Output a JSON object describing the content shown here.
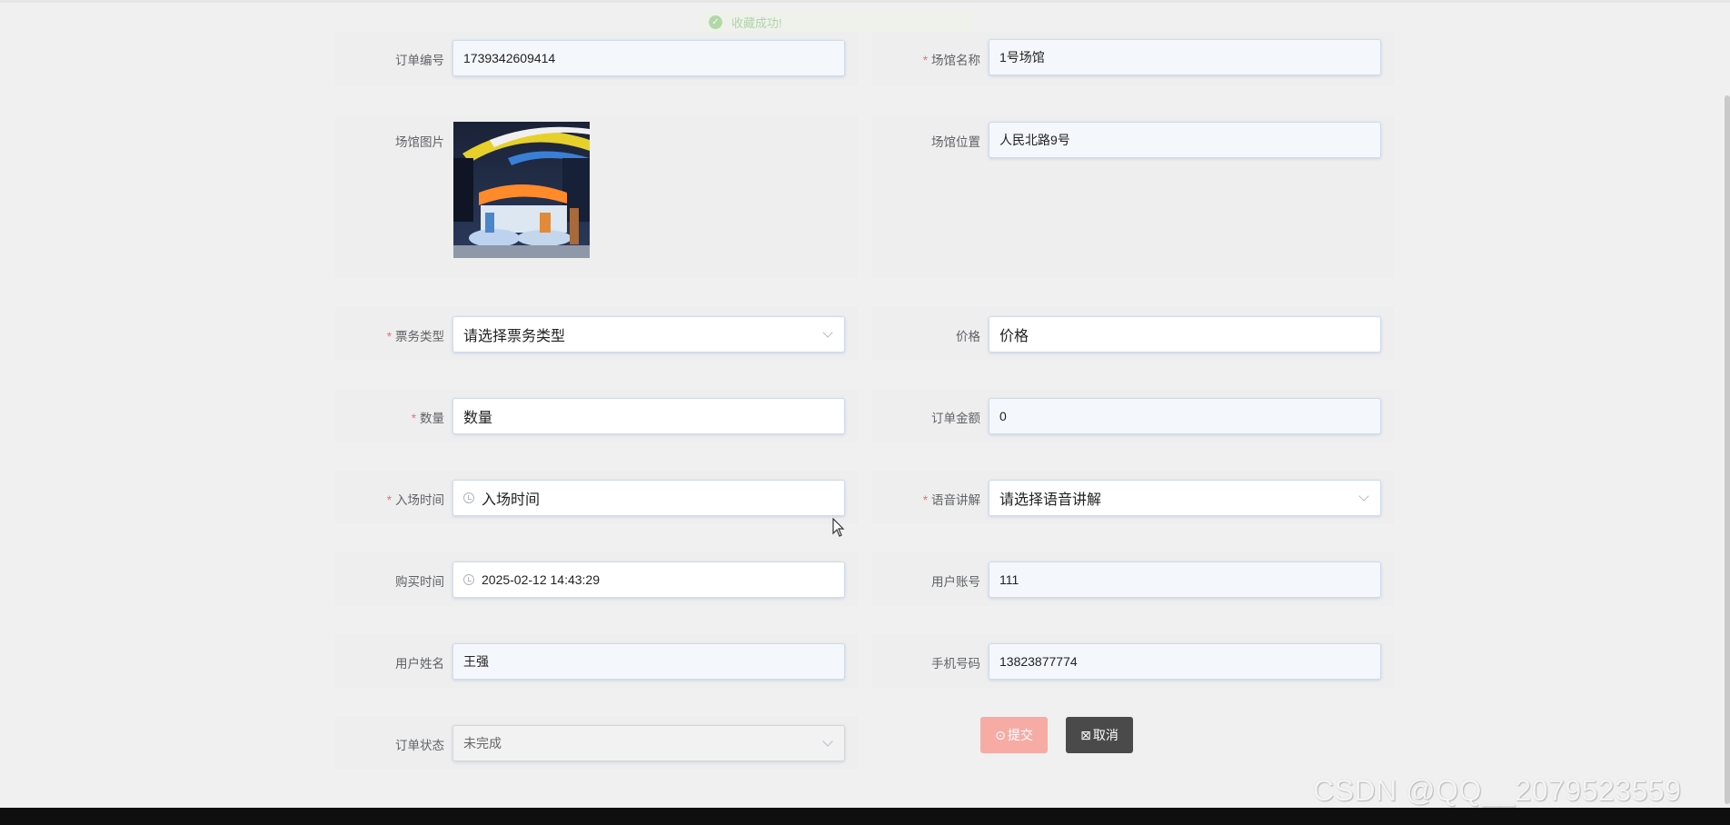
{
  "toast": {
    "text": "收藏成功!"
  },
  "form": {
    "order_no": {
      "label": "订单编号",
      "value": "1739342609414"
    },
    "venue_name": {
      "label": "场馆名称",
      "value": "1号场馆",
      "required": true
    },
    "venue_image": {
      "label": "场馆图片"
    },
    "venue_location": {
      "label": "场馆位置",
      "value": "人民北路9号"
    },
    "ticket_type": {
      "label": "票务类型",
      "placeholder": "请选择票务类型",
      "required": true
    },
    "price": {
      "label": "价格",
      "placeholder": "价格"
    },
    "quantity": {
      "label": "数量",
      "placeholder": "数量",
      "required": true
    },
    "order_amount": {
      "label": "订单金额",
      "value": "0"
    },
    "entry_time": {
      "label": "入场时间",
      "placeholder": "入场时间",
      "required": true
    },
    "audio_guide": {
      "label": "语音讲解",
      "placeholder": "请选择语音讲解",
      "required": true
    },
    "purchase_time": {
      "label": "购买时间",
      "value": "2025-02-12 14:43:29"
    },
    "user_account": {
      "label": "用户账号",
      "value": "111"
    },
    "user_name": {
      "label": "用户姓名",
      "value": "王强"
    },
    "phone": {
      "label": "手机号码",
      "value": "13823877774"
    },
    "order_status": {
      "label": "订单状态",
      "value": "未完成"
    }
  },
  "buttons": {
    "submit": "提交",
    "cancel": "取消"
  },
  "watermark": "CSDN @QQ__2079523559",
  "colors": {
    "required": "#f56c6c",
    "submit": "#f6aba5",
    "cancel": "#4a4a4a"
  }
}
